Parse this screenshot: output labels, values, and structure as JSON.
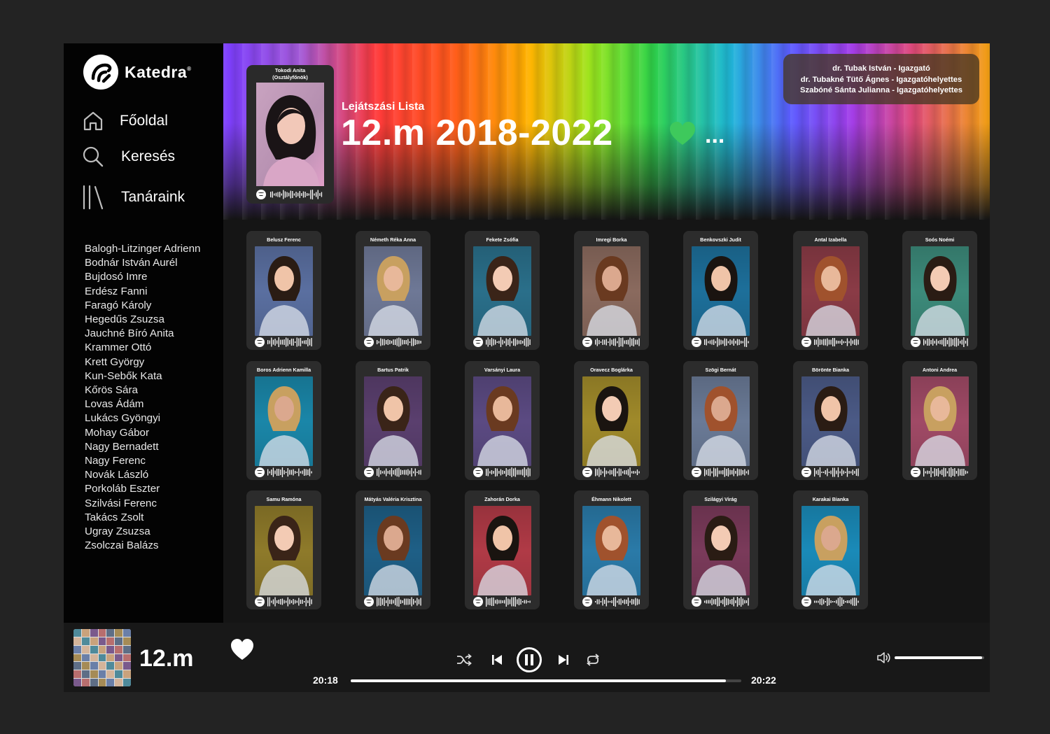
{
  "app": {
    "name": "Katedra",
    "mark": "®"
  },
  "nav": [
    {
      "label": "Főoldal",
      "icon": "home-icon"
    },
    {
      "label": "Keresés",
      "icon": "search-icon"
    },
    {
      "label": "Tanáraink",
      "icon": "library-icon"
    }
  ],
  "teachers": [
    "Balogh-Litzinger Adrienn",
    "Bodnár István Aurél",
    "Bujdosó Imre",
    "Erdész Fanni",
    "Faragó Károly",
    "Hegedűs Zsuzsa",
    "Jauchné Bíró Anita",
    "Krammer Ottó",
    "Krett György",
    "Kun-Sebők Kata",
    "Kőrös Sára",
    "Lovas Ádám",
    "Lukács Gyöngyi",
    "Mohay Gábor",
    "Nagy Bernadett",
    "Nagy Ferenc",
    "Novák László",
    "Porkoláb Eszter",
    "Szilvási Ferenc",
    "Takács Zsolt",
    "Ugray Zsuzsa",
    "Zsolczai Balázs"
  ],
  "header": {
    "homeroom_name": "Tokodi Anita",
    "homeroom_role": "(Osztályfőnök)",
    "type": "Lejátszási Lista",
    "title": "12.m 2018-2022",
    "more": "...",
    "leaders": [
      "dr. Tubak István - Igazgató",
      "dr. Tubakné Tütő Ágnes - Igazgatóhelyettes",
      "Szabóné Sánta Julianna - Igazgatóhelyettes"
    ]
  },
  "students": [
    {
      "name": "Belusz Ferenc",
      "bg": "#5a6fa0"
    },
    {
      "name": "Németh Réka Anna",
      "bg": "#6e7896"
    },
    {
      "name": "Fekete Zsófia",
      "bg": "#2a6f8a"
    },
    {
      "name": "Imregi Borka",
      "bg": "#8a6a5e"
    },
    {
      "name": "Benkovszki Judit",
      "bg": "#1d6f9a"
    },
    {
      "name": "Antal Izabella",
      "bg": "#8a3b46"
    },
    {
      "name": "Soós Noémi",
      "bg": "#3c8a7a"
    },
    {
      "name": "Boros Adrienn Kamilla",
      "bg": "#1a86a8"
    },
    {
      "name": "Bartus Patrik",
      "bg": "#5a3f6e"
    },
    {
      "name": "Varsányi Laura",
      "bg": "#5b4a82"
    },
    {
      "name": "Oravecz Boglárka",
      "bg": "#a08a2a"
    },
    {
      "name": "Szögi Bernát",
      "bg": "#6a7a96"
    },
    {
      "name": "Böröntе Bianka",
      "bg": "#4b5a86"
    },
    {
      "name": "Antoni Andrea",
      "bg": "#a04a66"
    },
    {
      "name": "Samu Ramóna",
      "bg": "#8e7a2a"
    },
    {
      "name": "Mátyás Valéria Krisztina",
      "bg": "#1e5f86"
    },
    {
      "name": "Zahorán Dorka",
      "bg": "#b03a46"
    },
    {
      "name": "Éhmann Nikolett",
      "bg": "#2a7aa8"
    },
    {
      "name": "Szilágyi Virág",
      "bg": "#7a3a5a"
    },
    {
      "name": "Karakai Bianka",
      "bg": "#1a8ab8"
    }
  ],
  "player": {
    "track": "12.m",
    "time_elapsed": "20:18",
    "time_total": "20:22",
    "progress": 0.96,
    "volume": 0.98
  },
  "colors": {
    "accent_heart": "#3ec95c",
    "sidebar": "#030303",
    "card": "#2c2c2c"
  }
}
